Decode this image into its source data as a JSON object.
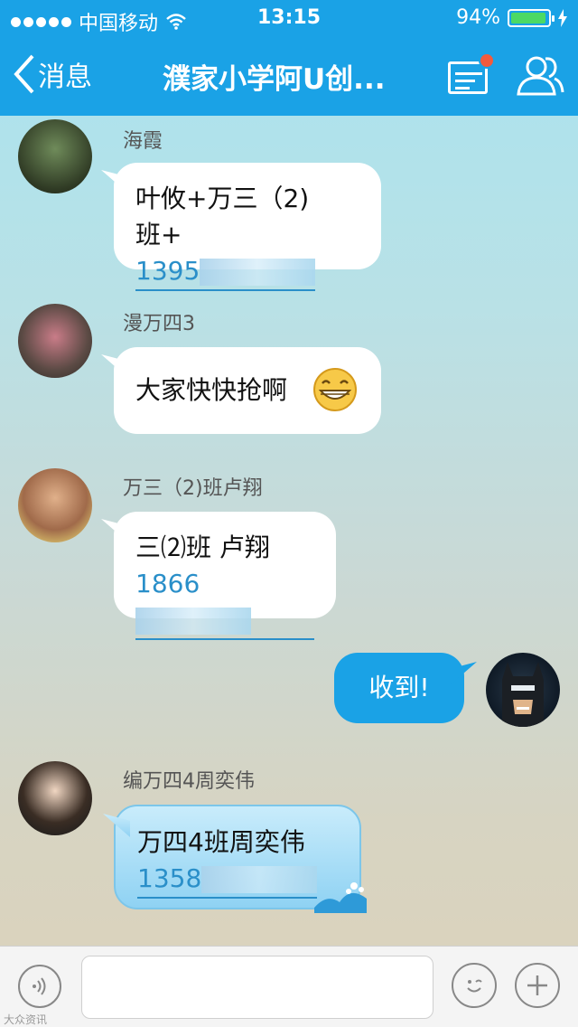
{
  "status_bar": {
    "carrier": "中国移动",
    "time": "13:15",
    "battery": "94%"
  },
  "nav": {
    "back_label": "消息",
    "title": "濮家小学阿U创..."
  },
  "messages": [
    {
      "sender": "海霞",
      "line1": "叶攸+万三（2)",
      "line2_prefix": "班+",
      "phone": "1395"
    },
    {
      "sender": "漫万四3",
      "text": "大家快快抢啊"
    },
    {
      "sender": "万三（2)班卢翔",
      "line1": "三⑵班 卢翔",
      "phone": "1866"
    },
    {
      "sender": "编万四4周奕伟",
      "line1": "万四4班周奕伟",
      "phone": "1358"
    }
  ],
  "my_message": {
    "text": "收到!"
  },
  "watermark": "大众资讯",
  "colors": {
    "nav_bg": "#1aa2e6",
    "link": "#2a8fc9",
    "badge": "#f25a3d"
  }
}
